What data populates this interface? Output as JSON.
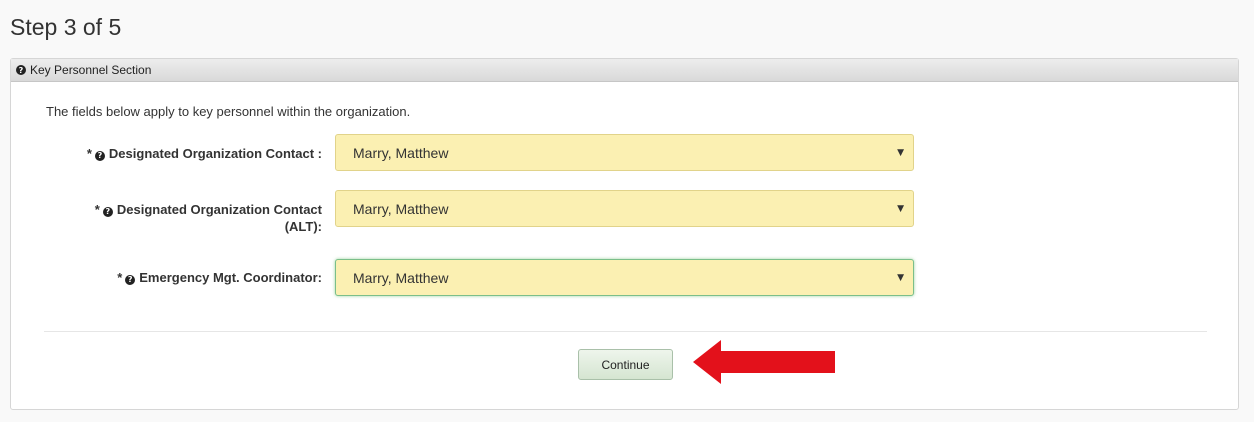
{
  "page": {
    "step_title": "Step 3 of 5"
  },
  "panel": {
    "heading": "Key Personnel Section",
    "intro": "The fields below apply to key personnel within the organization."
  },
  "fields": [
    {
      "required_mark": "*",
      "label_line1": "Designated Organization Contact :",
      "label_line2": "",
      "value": "Marry, Matthew"
    },
    {
      "required_mark": "*",
      "label_line1": "Designated Organization Contact",
      "label_line2": "(ALT):",
      "value": "Marry, Matthew"
    },
    {
      "required_mark": "*",
      "label_line1": "Emergency Mgt. Coordinator:",
      "label_line2": "",
      "value": "Marry, Matthew"
    }
  ],
  "actions": {
    "continue_label": "Continue"
  },
  "icons": {
    "help": "question-circle-icon",
    "dropdown": "caret-down-icon",
    "annotation": "red-arrow-left"
  },
  "colors": {
    "select_bg": "#fbf0b2",
    "button_bg": "#d5e5d1",
    "arrow": "#e3111b"
  }
}
